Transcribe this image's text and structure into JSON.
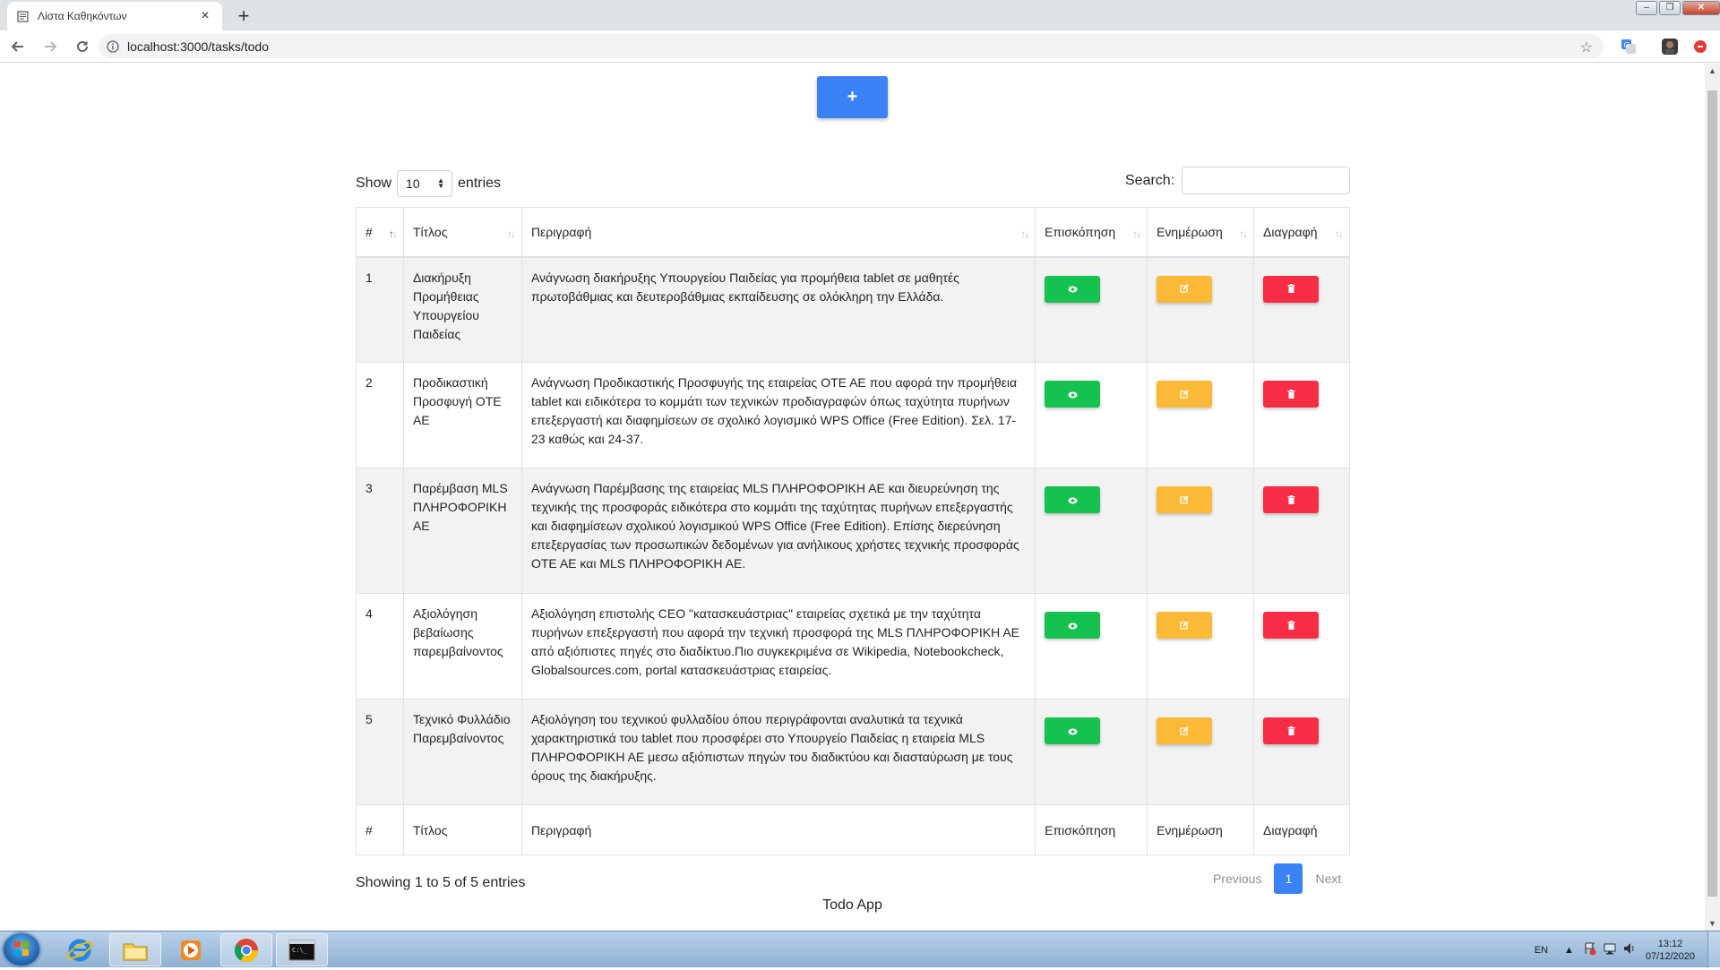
{
  "browser": {
    "tab_title": "Λίστα Καθηκόντων",
    "tab_close": "×",
    "new_tab": "+",
    "url": "localhost:3000/tasks/todo"
  },
  "page": {
    "add_button": "+",
    "length_label_before": "Show",
    "length_value": "10",
    "length_label_after": "entries",
    "search_label": "Search:",
    "search_value": "",
    "columns": [
      "#",
      "Τίτλος",
      "Περιγραφή",
      "Επισκόπηση",
      "Ενημέρωση",
      "Διαγραφή"
    ],
    "rows": [
      {
        "num": "1",
        "title": "Διακήρυξη Προμήθειας Υπουργείου Παιδείας",
        "description": "Ανάγνωση διακήρυξης Υπουργείου Παιδείας για προμήθεια tablet σε μαθητές πρωτοβάθμιας και δευτεροβάθμιας εκπαίδευσης σε ολόκληρη την Ελλάδα."
      },
      {
        "num": "2",
        "title": "Προδικαστική Προσφυγή ΟΤΕ ΑΕ",
        "description": "Ανάγνωση Προδικαστικής Προσφυγής της εταιρείας ΟΤΕ ΑΕ που αφορά την προμήθεια tablet και ειδικότερα το κομμάτι των τεχνικών προδιαγραφών όπως ταχύτητα πυρήνων επεξεργαστή και διαφημίσεων σε σχολικό λογισμικό WPS Office (Free Edition). Σελ. 17-23 καθώς και 24-37."
      },
      {
        "num": "3",
        "title": "Παρέμβαση MLS ΠΛΗΡΟΦΟΡΙΚΗ ΑΕ",
        "description": "Ανάγνωση Παρέμβασης της εταιρείας MLS ΠΛΗΡΟΦΟΡΙΚΗ ΑΕ και διευρεύνηση της τεχνικής της προσφοράς ειδικότερα στο κομμάτι της ταχύτητας πυρήνων επεξεργαστής και διαφημίσεων σχολικού λογισμικού WPS Office (Free Edition). Επίσης διερεύνηση επεξεργασίας των προσωπικών δεδομένων για ανήλικους χρήστες τεχνικής προσφοράς ΟΤΕ ΑΕ και MLS ΠΛΗΡΟΦΟΡΙΚΗ ΑΕ."
      },
      {
        "num": "4",
        "title": "Αξιολόγηση βεβαίωσης παρεμβαίνοντος",
        "description": "Αξιολόγηση επιστολής CEO \"κατασκευάστριας\" εταιρείας σχετικά με την ταχύτητα πυρήνων επεξεργαστή που αφορά την τεχνική προσφορά της MLS ΠΛΗΡΟΦΟΡΙΚΗ ΑΕ από αξιόπιστες πηγές στο διαδίκτυο.Πιο συγκεκριμένα σε Wikipedia, Notebookcheck, Globalsources.com, portal κατασκευάστριας εταιρείας."
      },
      {
        "num": "5",
        "title": "Τεχνικό Φυλλάδιο Παρεμβαίνοντος",
        "description": "Αξιολόγηση του τεχνικού φυλλαδίου όπου περιγράφονται αναλυτικά τα τεχνικά χαρακτηριστικά του tablet που προσφέρει στο Υπουργείο Παιδείας η εταιρεία MLS ΠΛΗΡΟΦΟΡΙΚΗ ΑΕ μεσω αξιόπιστων πηγών του διαδικτύου και διασταύρωση με τους όρους της διακήρυξης."
      }
    ],
    "info": "Showing 1 to 5 of 5 entries",
    "pagination": {
      "previous": "Previous",
      "current": "1",
      "next": "Next"
    },
    "footer": "Todo App"
  },
  "taskbar": {
    "lang": "EN",
    "time": "13:12",
    "date": "07/12/2020"
  },
  "colors": {
    "primary": "#3b82f6",
    "view": "#16c24f",
    "edit": "#fbb938",
    "delete": "#f72d45"
  }
}
